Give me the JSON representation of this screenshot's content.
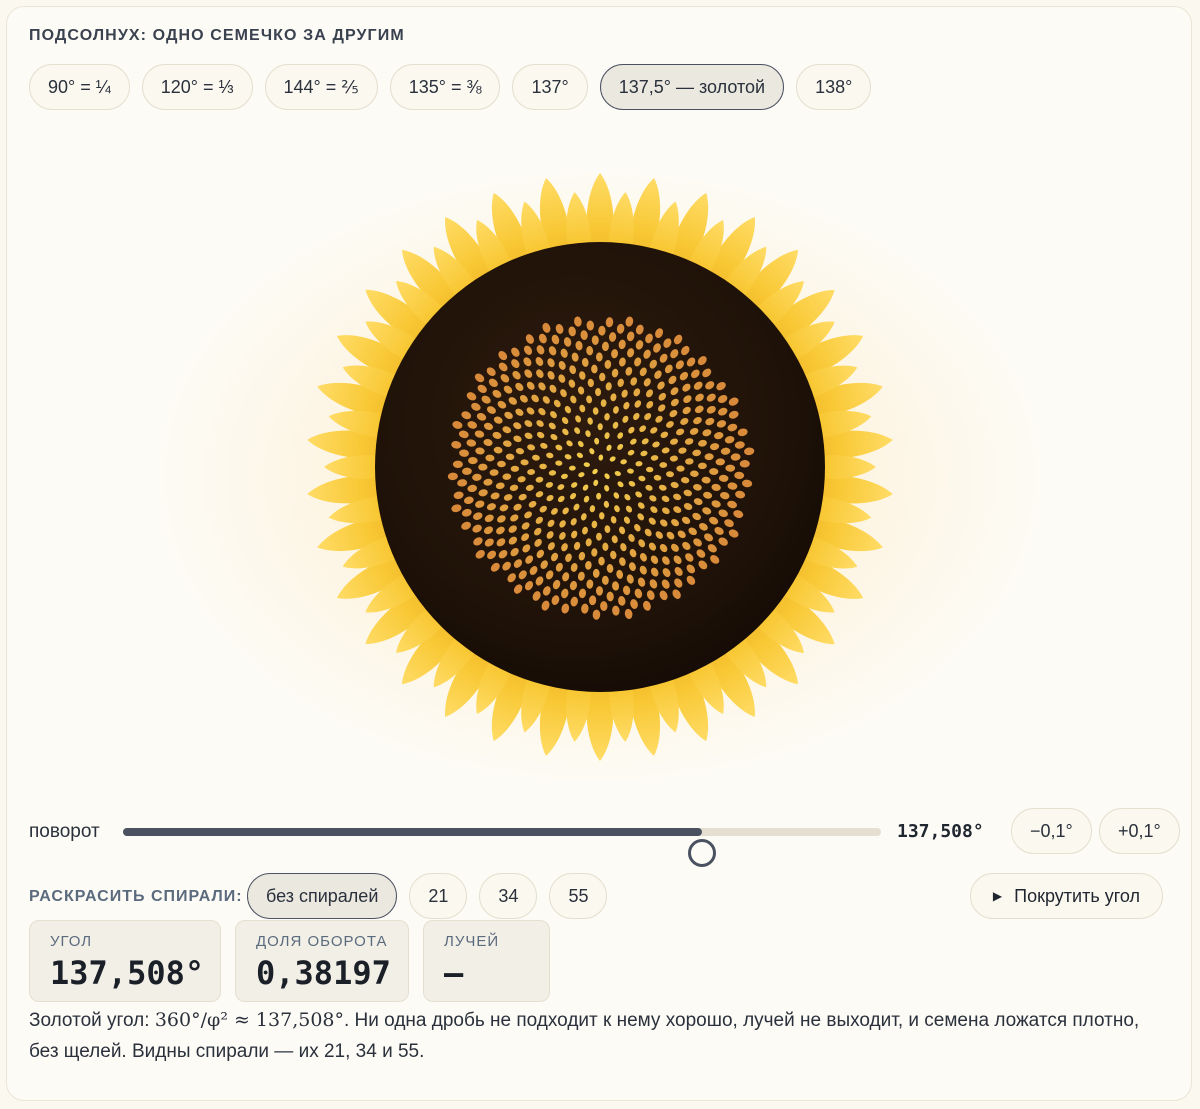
{
  "title": "ПОДСОЛНУХ: ОДНО СЕМЕЧКО ЗА ДРУГИМ",
  "presets": [
    {
      "label": "90° = ¼",
      "active": false
    },
    {
      "label": "120° = ⅓",
      "active": false
    },
    {
      "label": "144° = ⅖",
      "active": false
    },
    {
      "label": "135° = ⅜",
      "active": false
    },
    {
      "label": "137°",
      "active": false
    },
    {
      "label": "137,5° — золотой",
      "active": true
    },
    {
      "label": "138°",
      "active": false
    }
  ],
  "flower": {
    "angle_deg": 137.508,
    "seed_count": 500,
    "petal_color": "#f5c431",
    "petal_color_light": "#ffd95c",
    "disk_color": "#231409",
    "seed_color_center": "#f4d24e",
    "seed_color_edge": "#d8893a"
  },
  "slider": {
    "label": "поворот",
    "min_deg": 0,
    "max_deg": 180,
    "value_deg": 137.508,
    "readout": "137,508°",
    "minus_label": "−0,1°",
    "plus_label": "+0,1°"
  },
  "spirals": {
    "label": "РАСКРАСИТЬ СПИРАЛИ:",
    "options": [
      {
        "label": "без спиралей",
        "active": true
      },
      {
        "label": "21",
        "active": false
      },
      {
        "label": "34",
        "active": false
      },
      {
        "label": "55",
        "active": false
      }
    ],
    "spin_label": "Покрутить угол"
  },
  "stats": {
    "angle": {
      "label": "УГОЛ",
      "value": "137,508°"
    },
    "fraction": {
      "label": "ДОЛЯ ОБОРОТА",
      "value": "0,38197"
    },
    "rays": {
      "label": "ЛУЧЕЙ",
      "value": "—"
    }
  },
  "description": {
    "prefix": "Золотой угол: ",
    "formula": "360°/φ² ≈ 137,508°",
    "suffix": ". Ни одна дробь не подходит к нему хорошо, лучей не выходит, и семена ложатся плотно, без щелей. Видны спирали — их 21, 34 и 55."
  }
}
